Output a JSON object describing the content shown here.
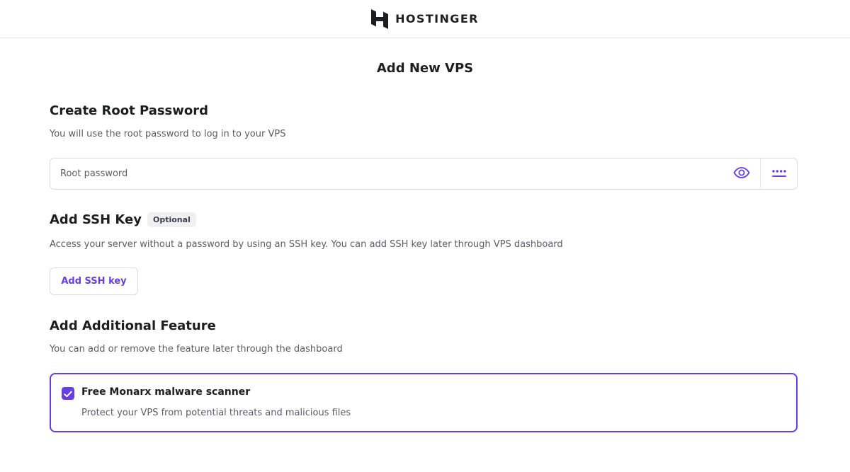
{
  "brand": {
    "name": "HOSTINGER",
    "logo_icon": "hostinger-logo-icon"
  },
  "page": {
    "title": "Add New VPS"
  },
  "root_password": {
    "title": "Create Root Password",
    "description": "You will use the root password to log in to your VPS",
    "placeholder": "Root password",
    "value": "",
    "show_icon": "eye-icon",
    "generate_icon": "generate-password-icon"
  },
  "ssh_key": {
    "title": "Add SSH Key",
    "badge": "Optional",
    "description": "Access your server without a password by using an SSH key. You can add SSH key later through VPS dashboard",
    "button_label": "Add SSH key"
  },
  "additional_feature": {
    "title": "Add Additional Feature",
    "description": "You can add or remove the feature later through the dashboard",
    "feature": {
      "checked": true,
      "title": "Free Monarx malware scanner",
      "description": "Protect your VPS from potential threats and malicious files"
    }
  },
  "colors": {
    "accent": "#673de6",
    "text_dark": "#1d1e20",
    "text_muted": "#5c5c66",
    "border": "#dadce0"
  }
}
